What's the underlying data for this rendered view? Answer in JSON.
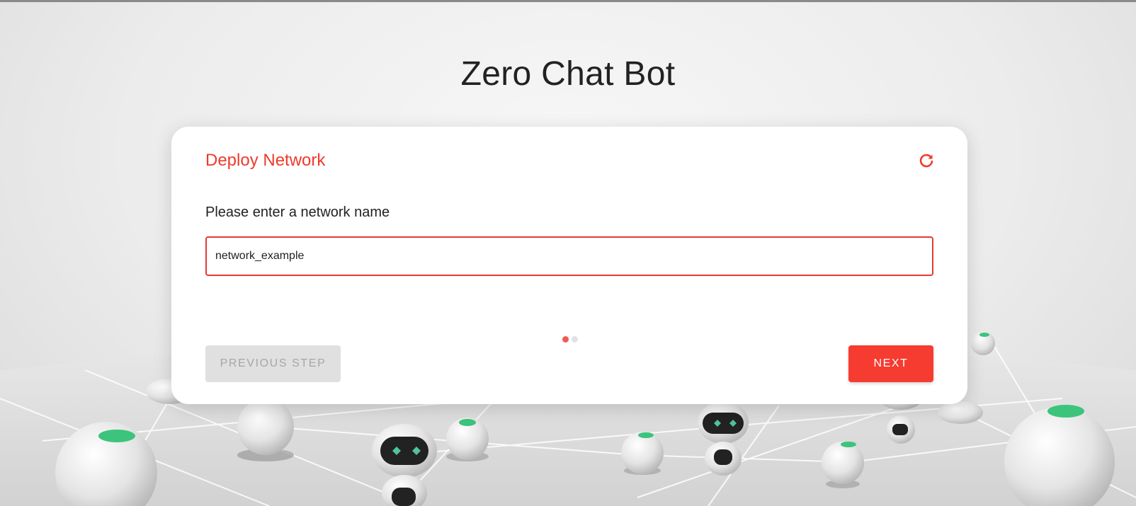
{
  "app": {
    "title": "Zero Chat Bot"
  },
  "wizard": {
    "title": "Deploy Network",
    "prompt": "Please enter a network name",
    "input_value": "network_example",
    "current_step": 1,
    "total_steps": 2,
    "prev_label": "PREVIOUS STEP",
    "next_label": "NEXT",
    "refresh_icon": "refresh-icon"
  },
  "colors": {
    "accent": "#f0392b",
    "button": "#f63b30",
    "disabled_button": "#e0e0e0",
    "input_border": "#e53935"
  }
}
